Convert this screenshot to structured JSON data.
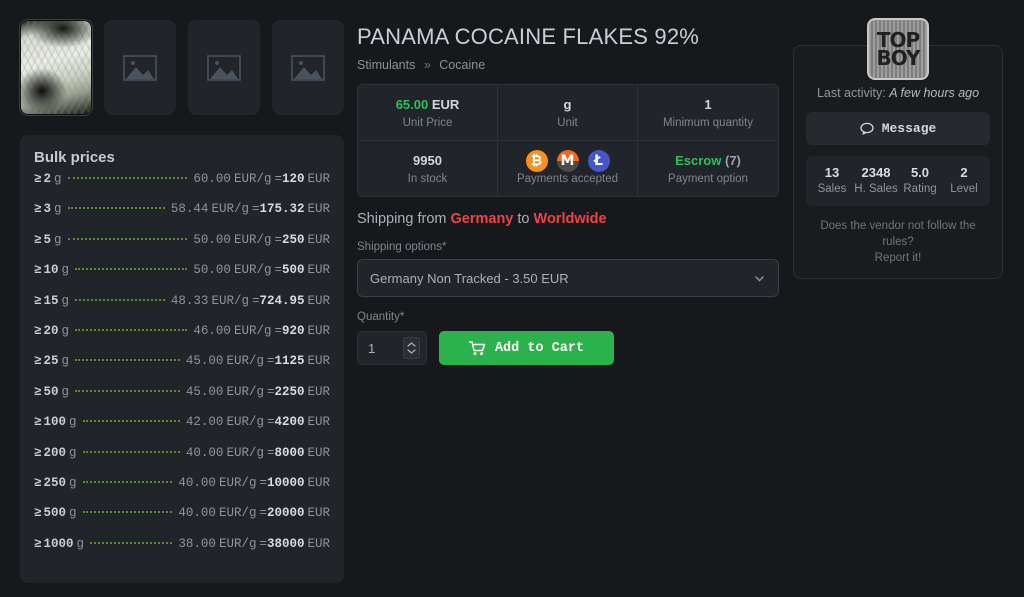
{
  "gallery": {
    "thumbnails": [
      {
        "name": "product-photo",
        "selected": true,
        "placeholder": false
      },
      {
        "name": "image-placeholder",
        "selected": false,
        "placeholder": true
      },
      {
        "name": "image-placeholder",
        "selected": false,
        "placeholder": true
      },
      {
        "name": "image-placeholder",
        "selected": false,
        "placeholder": true
      }
    ]
  },
  "bulk": {
    "title": "Bulk prices",
    "ge_symbol": "≥",
    "unit": "g",
    "eq": "=",
    "rate_unit": "EUR/g",
    "currency": "EUR",
    "rows": [
      {
        "qty": "2",
        "rate": "60.00",
        "total": "120"
      },
      {
        "qty": "3",
        "rate": "58.44",
        "total": "175.32"
      },
      {
        "qty": "5",
        "rate": "50.00",
        "total": "250"
      },
      {
        "qty": "10",
        "rate": "50.00",
        "total": "500"
      },
      {
        "qty": "15",
        "rate": "48.33",
        "total": "724.95"
      },
      {
        "qty": "20",
        "rate": "46.00",
        "total": "920"
      },
      {
        "qty": "25",
        "rate": "45.00",
        "total": "1125"
      },
      {
        "qty": "50",
        "rate": "45.00",
        "total": "2250"
      },
      {
        "qty": "100",
        "rate": "42.00",
        "total": "4200"
      },
      {
        "qty": "200",
        "rate": "40.00",
        "total": "8000"
      },
      {
        "qty": "250",
        "rate": "40.00",
        "total": "10000"
      },
      {
        "qty": "500",
        "rate": "40.00",
        "total": "20000"
      },
      {
        "qty": "1000",
        "rate": "38.00",
        "total": "38000"
      }
    ]
  },
  "product": {
    "title": "PANAMA COCAINE FLAKES 92%",
    "breadcrumb": {
      "category": "Stimulants",
      "separator": "»",
      "subcategory": "Cocaine"
    },
    "info": {
      "unit_price_value": "65.00",
      "unit_price_currency": "EUR",
      "unit_price_label": "Unit Price",
      "unit_value": "g",
      "unit_label": "Unit",
      "min_qty_value": "1",
      "min_qty_label": "Minimum quantity",
      "stock_value": "9950",
      "stock_label": "In stock",
      "payments_label": "Payments accepted",
      "payments": [
        {
          "name": "bitcoin-icon",
          "glyph": "₿"
        },
        {
          "name": "monero-icon",
          "glyph": "M"
        },
        {
          "name": "litecoin-icon",
          "glyph": "Ł"
        }
      ],
      "escrow_value": "Escrow",
      "escrow_count": "(7)",
      "escrow_label": "Payment option"
    },
    "shipping": {
      "prefix": "Shipping from ",
      "from": "Germany",
      "middle": " to ",
      "to": "Worldwide",
      "options_label": "Shipping options*",
      "selected_option": "Germany Non Tracked - 3.50 EUR"
    },
    "quantity_label": "Quantity*",
    "quantity_value": "1",
    "add_to_cart_label": "Add to Cart"
  },
  "vendor": {
    "avatar_line1": "TOP",
    "avatar_line2": "BOY",
    "last_activity_prefix": "Last activity: ",
    "last_activity_value": "A few hours ago",
    "message_label": "Message",
    "stats": [
      {
        "value": "13",
        "label": "Sales"
      },
      {
        "value": "2348",
        "label": "H. Sales"
      },
      {
        "value": "5.0",
        "label": "Rating"
      },
      {
        "value": "2",
        "label": "Level"
      }
    ],
    "report_line1": "Does the vendor not follow the rules?",
    "report_line2": "Report it!"
  },
  "colors": {
    "page_bg": "#16181b",
    "panel_bg": "#212428",
    "accent_green": "#2fbf5c",
    "cart_green": "#2bb24c",
    "accent_red": "#ef4444",
    "leader_green": "#5d8a2b"
  }
}
